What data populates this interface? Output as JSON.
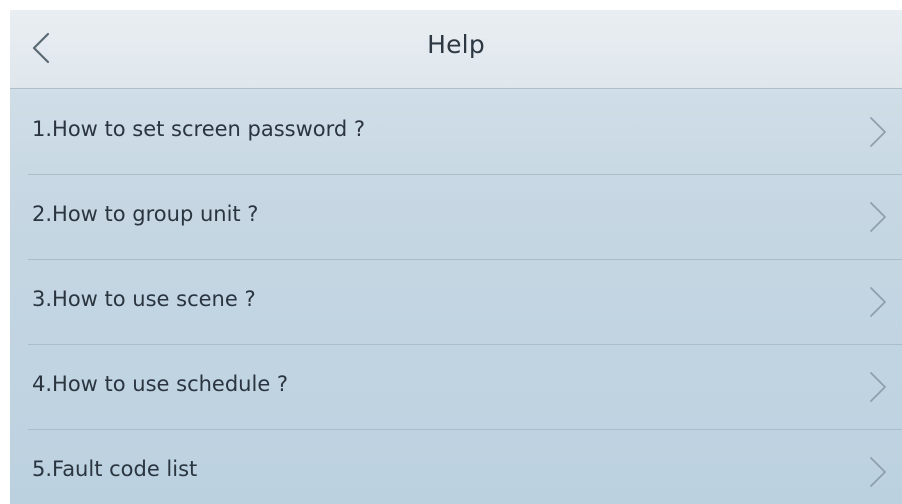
{
  "header": {
    "title": "Help",
    "back_icon": "chevron-left-icon"
  },
  "help_items": [
    {
      "label": "1.How to set screen password ?",
      "icon": "chevron-right-icon"
    },
    {
      "label": "2.How to group unit ?",
      "icon": "chevron-right-icon"
    },
    {
      "label": "3.How to use scene ?",
      "icon": "chevron-right-icon"
    },
    {
      "label": "4.How to use schedule ?",
      "icon": "chevron-right-icon"
    },
    {
      "label": "5.Fault code list",
      "icon": "chevron-right-icon"
    }
  ],
  "colors": {
    "header_background": "#e6ecf0",
    "list_background": "#c6d7e3",
    "divider": "#a9bdcb",
    "text": "#2a3540",
    "chevron": "#8fa0ad"
  }
}
